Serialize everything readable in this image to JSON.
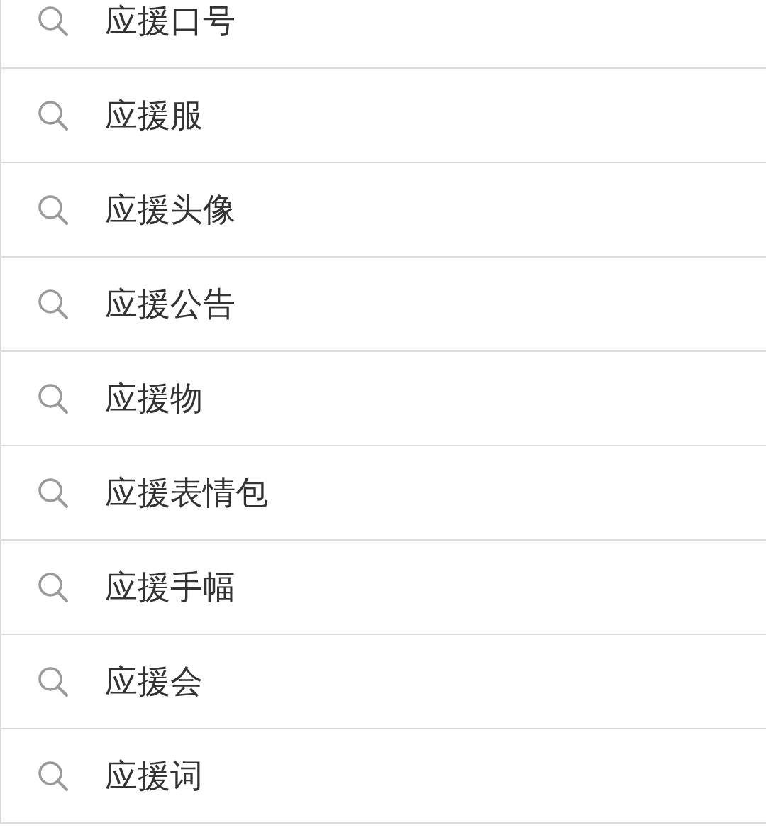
{
  "suggestions": [
    {
      "text": "应援口号"
    },
    {
      "text": "应援服"
    },
    {
      "text": "应援头像"
    },
    {
      "text": "应援公告"
    },
    {
      "text": "应援物"
    },
    {
      "text": "应援表情包"
    },
    {
      "text": "应援手幅"
    },
    {
      "text": "应援会"
    },
    {
      "text": "应援词"
    }
  ]
}
